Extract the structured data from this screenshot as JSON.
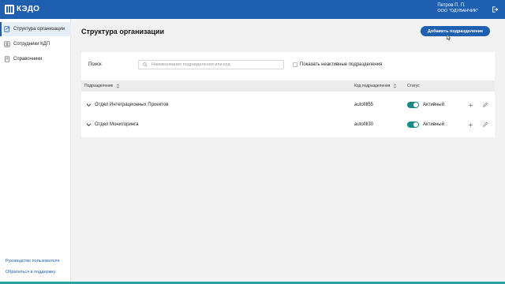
{
  "header": {
    "logo_text": "КЭДО",
    "user_name": "Петров П. П.",
    "company": "ООО \"ОДУВАНЧИК\""
  },
  "sidebar": {
    "items": [
      {
        "label": "Структура организации",
        "icon": "org-structure-icon",
        "active": true
      },
      {
        "label": "Сотрудники КДП",
        "icon": "employees-icon",
        "active": false
      },
      {
        "label": "Справочники",
        "icon": "book-icon",
        "active": false
      }
    ],
    "footer_links": [
      {
        "label": "Руководство пользователя"
      },
      {
        "label": "Обратиться в поддержку"
      }
    ]
  },
  "main": {
    "title": "Структура организации",
    "add_button": "Добавить подразделение",
    "filter": {
      "search_label": "Поиск",
      "search_placeholder": "Наименование подразделения или код",
      "show_inactive_label": "Показать неактивные подразделения",
      "show_inactive_checked": false
    },
    "table": {
      "columns": [
        "Подразделение",
        "Код подразделения",
        "Статус"
      ],
      "rows": [
        {
          "name": "Отдел Интеграционных Проектов",
          "code": "autofill55",
          "status": "Активный",
          "active": true
        },
        {
          "name": "Отдел Мониторинга",
          "code": "autofill30",
          "status": "Активный",
          "active": true
        }
      ]
    }
  },
  "colors": {
    "brand": "#1f5fb0",
    "toggle_on": "#1a8a86",
    "background": "#f2f2f2"
  }
}
